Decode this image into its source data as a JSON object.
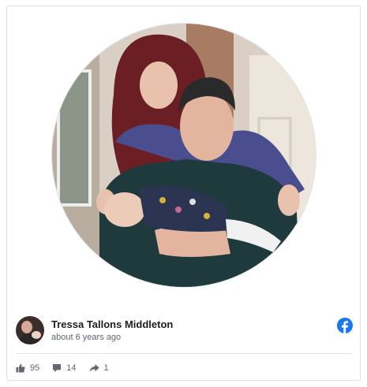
{
  "post": {
    "author": "Tressa Tallons Middleton",
    "timestamp": "about 6 years ago",
    "platform_icon": "facebook-icon"
  },
  "stats": {
    "likes": "95",
    "comments": "14",
    "shares": "1"
  },
  "colors": {
    "facebook_blue": "#1877f2",
    "text_primary": "#1c1e21",
    "text_secondary": "#606770"
  }
}
